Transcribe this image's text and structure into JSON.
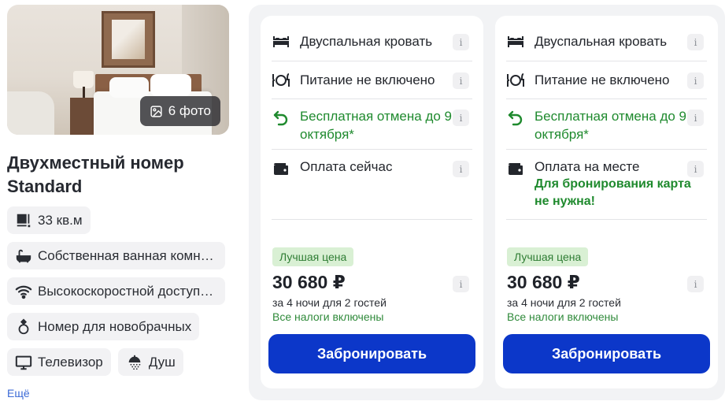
{
  "room": {
    "photo_count_label": "6 фото",
    "title": "Двухместный номер Standard",
    "amenities": [
      {
        "icon": "room-size-icon",
        "label": "33 кв.м"
      },
      {
        "icon": "bathtub-icon",
        "label": "Собственная ванная комн…"
      },
      {
        "icon": "wifi-icon",
        "label": "Высокоскоростной доступ…"
      },
      {
        "icon": "rings-icon",
        "label": "Номер для новобрачных"
      },
      {
        "icon": "tv-icon",
        "label": "Телевизор"
      },
      {
        "icon": "shower-icon",
        "label": "Душ"
      }
    ],
    "more_label": "Ещё"
  },
  "offers": [
    {
      "bed": "Двуспальная кровать",
      "meal": "Питание не включено",
      "cancel": "Бесплатная отмена до 9 октября*",
      "payment": "Оплата сейчас",
      "payment_note": "",
      "badge": "Лучшая цена",
      "price": "30 680 ₽",
      "nights": "за 4 ночи для 2 гостей",
      "taxes": "Все налоги включены",
      "book_label": "Забронировать"
    },
    {
      "bed": "Двуспальная кровать",
      "meal": "Питание не включено",
      "cancel": "Бесплатная отмена до 9 октября*",
      "payment": "Оплата на месте",
      "payment_note": "Для бронирования карта не нужна!",
      "badge": "Лучшая цена",
      "price": "30 680 ₽",
      "nights": "за 4 ночи для 2 гостей",
      "taxes": "Все налоги включены",
      "book_label": "Забронировать"
    }
  ],
  "info_glyph": "i",
  "colors": {
    "accent": "#0c37c9",
    "green": "#1f8a2e",
    "badge_bg": "#d9f0d4",
    "panel_bg": "#f2f3f5"
  }
}
